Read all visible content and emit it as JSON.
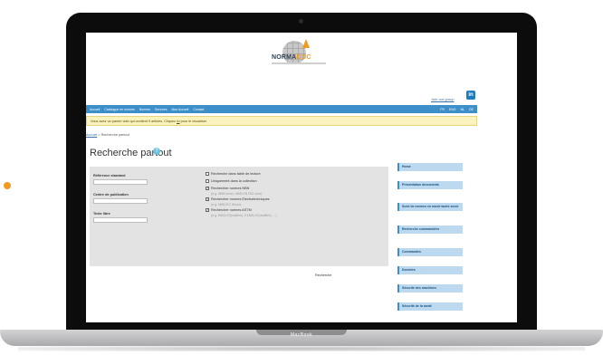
{
  "device": {
    "label": "MacBook"
  },
  "logo": {
    "text_main": "NORMA",
    "text_accent": "DOC"
  },
  "header": {
    "join_link": "Join our group",
    "linkedin_icon": "in"
  },
  "nav": {
    "left_items": [
      "Accueil",
      "Catalogue en normes",
      "Normes",
      "Services",
      "Mon Accueil",
      "Contact"
    ],
    "right_items": [
      "FR",
      "ENG",
      "NL",
      "DE"
    ]
  },
  "notice": {
    "text_before": "Vous avez un panier vide qui contient 0 articles. Cliquez ",
    "link": "ici",
    "text_after": " pour le visualiser"
  },
  "breadcrumb": {
    "home": "Accueil",
    "separator": " > ",
    "current": "Recherche partout"
  },
  "page": {
    "title": "Recherche partout"
  },
  "form": {
    "fields": [
      {
        "label": "Référence standard",
        "value": ""
      },
      {
        "label": "Centre de publication",
        "value": ""
      },
      {
        "label": "Texte libre",
        "value": ""
      }
    ],
    "options": [
      {
        "label": "Recherche dans table de lecture",
        "checked": false
      },
      {
        "label": "Uniquement dans la collection",
        "checked": false
      },
      {
        "label": "Rechercher normes NBN",
        "checked": true
      },
      {
        "label": "Rechercher normes Electrotechniques",
        "checked": true
      },
      {
        "label": "Rechercher normes ASTM",
        "checked": true
      }
    ],
    "hints": [
      "(e.g. NBN xxxxx, NBN EN ISO xxxx)",
      "(e.g. NBN IEC 60xxx)",
      "(e.g. E609-97(reaffirm), E1505-97(reaffirm), ...)"
    ],
    "search_label": "Recherche"
  },
  "sidebar": {
    "items": [
      "Home",
      "Présentation documents",
      "Suivi de normes en mode tacite seule",
      "Recherche commandées",
      "Commandes",
      "Données",
      "Sécurité des machines",
      "Sécurité de la santé"
    ]
  },
  "colors": {
    "accent_orange": "#f39a1e",
    "nav_blue": "#3d8fc9",
    "notice_yellow": "#fbf3bf"
  }
}
